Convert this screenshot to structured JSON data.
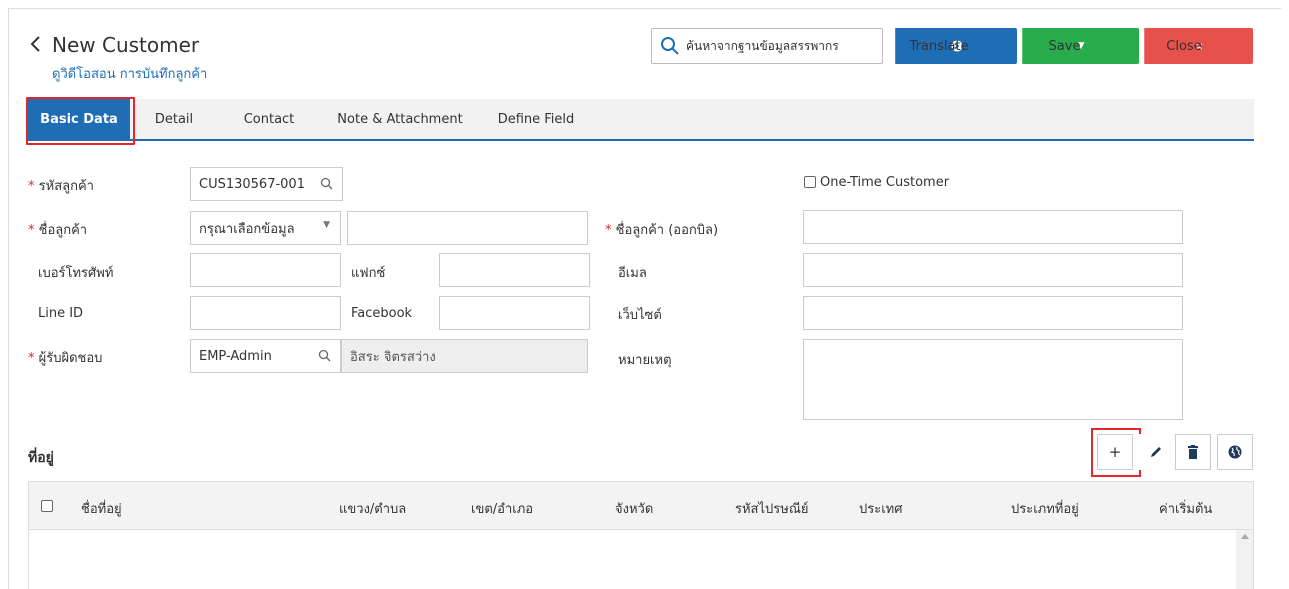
{
  "header": {
    "back_icon": "chevron-left-icon",
    "title": "New Customer",
    "subtitle": "ดูวิดีโอสอน การบันทึกลูกค้า",
    "search_label": "ค้นหาจากฐานข้อมูลสรรพากร",
    "translate_label": "Translate",
    "save_label": "Save",
    "close_label": "Close",
    "close_x": "×"
  },
  "tabs": [
    {
      "label": "Basic Data",
      "active": true
    },
    {
      "label": "Detail"
    },
    {
      "label": "Contact"
    },
    {
      "label": "Note & Attachment"
    },
    {
      "label": "Define Field"
    }
  ],
  "form": {
    "customer_code_label": "รหัสลูกค้า",
    "customer_code_value": "CUS130567-001",
    "one_time_label": "One-Time Customer",
    "customer_name_label": "ชื่อลูกค้า",
    "customer_name_select": "กรุณาเลือกข้อมูล",
    "customer_name_value": "",
    "billing_name_label": "ชื่อลูกค้า (ออกบิล)",
    "billing_name_value": "",
    "phone_label": "เบอร์โทรศัพท์",
    "phone_value": "",
    "fax_label": "แฟกซ์",
    "fax_value": "",
    "email_label": "อีเมล",
    "email_value": "",
    "line_label": "Line ID",
    "line_value": "",
    "facebook_label": "Facebook",
    "facebook_value": "",
    "website_label": "เว็บไซต์",
    "website_value": "",
    "responsible_label": "ผู้รับผิดชอบ",
    "responsible_code": "EMP-Admin",
    "responsible_name": "อิสระ จิตรสว่าง",
    "note_label": "หมายเหตุ",
    "required_mark": "*"
  },
  "address": {
    "title": "ที่อยู่",
    "add_label": "+",
    "columns": [
      "ชื่อที่อยู่",
      "แขวง/ตำบล",
      "เขต/อำเภอ",
      "จังหวัด",
      "รหัสไปรษณีย์",
      "ประเทศ",
      "ประเภทที่อยู่",
      "ค่าเริ่มต้น"
    ],
    "rows": []
  },
  "colors": {
    "primary": "#1f6db4",
    "save": "#2aac4c",
    "close": "#e8504b",
    "highlight": "#e4262a"
  }
}
